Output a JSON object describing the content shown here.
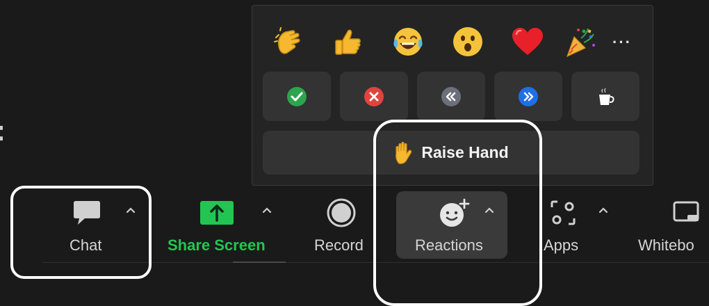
{
  "popup": {
    "emojis": [
      {
        "name": "clapping-hands-icon"
      },
      {
        "name": "thumbs-up-icon"
      },
      {
        "name": "tears-of-joy-icon"
      },
      {
        "name": "surprised-face-icon"
      },
      {
        "name": "heart-icon"
      },
      {
        "name": "party-popper-icon"
      }
    ],
    "more_label": "···",
    "status_buttons": [
      {
        "name": "yes-icon",
        "color": "#2da44e",
        "glyph": "✓"
      },
      {
        "name": "no-icon",
        "color": "#e0443e",
        "glyph": "✕"
      },
      {
        "name": "slower-icon",
        "color": "#6b6f7a",
        "glyph": "«"
      },
      {
        "name": "faster-icon",
        "color": "#1f6fe5",
        "glyph": "»"
      },
      {
        "name": "coffee-icon",
        "color": "#ffffff",
        "glyph": "☕"
      }
    ],
    "raise_hand_label": "Raise Hand"
  },
  "toolbar": {
    "chat_label": "Chat",
    "share_label": "Share Screen",
    "record_label": "Record",
    "reactions_label": "Reactions",
    "apps_label": "Apps",
    "whiteboard_label": "Whitebo"
  },
  "colors": {
    "share_green": "#23c552",
    "background": "#1a1a1a"
  }
}
